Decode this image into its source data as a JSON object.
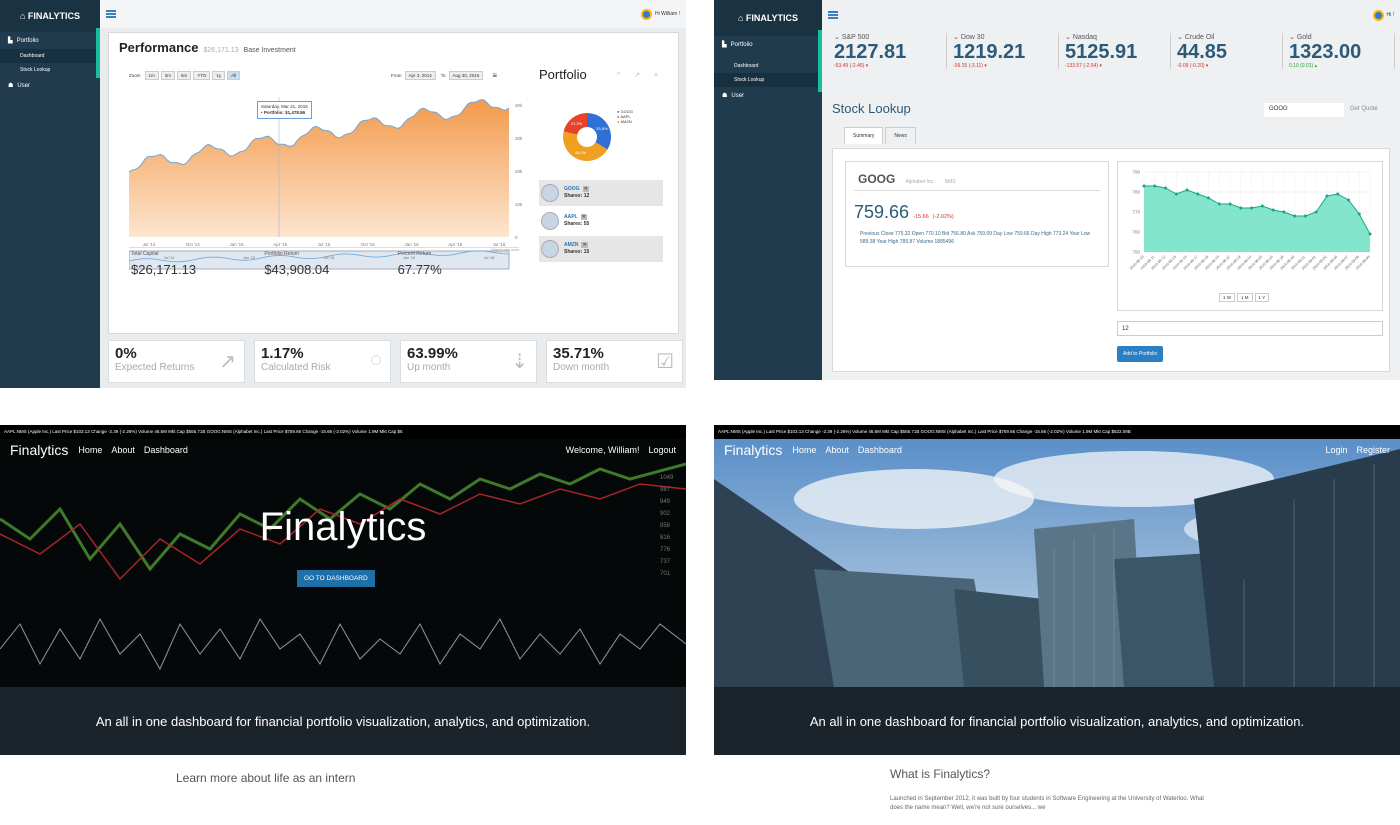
{
  "dashboard": {
    "brand": "FINALYTICS",
    "sidebar": [
      {
        "label": "Portfolio"
      },
      {
        "label": "Dashboard"
      },
      {
        "label": "Stock Lookup"
      },
      {
        "label": "User"
      }
    ],
    "user": "Hi William !",
    "title": "Performance",
    "base_amount": "$26,171.13",
    "base_label": "Base Investment",
    "zoom_label": "Zoom",
    "zoom_buttons": [
      "1m",
      "3m",
      "6m",
      "YTD",
      "1y",
      "All"
    ],
    "from_label": "From",
    "from_date": "Apr 3, 2014",
    "to_label": "To",
    "to_date": "Aug 30, 2016",
    "tooltip_date": "Saturday, Mar 21, 2015",
    "tooltip_value": "• Portfolio: $1,478.86",
    "y_ticks": [
      "40k",
      "30k",
      "20k",
      "10k",
      "0"
    ],
    "x_ticks": [
      "Jul '14",
      "Oct '14",
      "Jan '15",
      "Apr '15",
      "Jul '15",
      "Oct '15",
      "Jan '16",
      "Apr '16",
      "Jul '16"
    ],
    "nav_ticks": [
      "Jul '14",
      "Jan '15",
      "Jul '15",
      "Jan '16",
      "Jul '16"
    ],
    "credit": "Highcharts.com",
    "summary": [
      {
        "label": "Total Capital",
        "value": "$26,171.13"
      },
      {
        "label": "Portfolio Return",
        "value": "$43,908.04"
      },
      {
        "label": "Percent Return",
        "value": "67.77%"
      }
    ],
    "portfolio_title": "Portfolio",
    "pie_legend": [
      "GOOG",
      "AAPL",
      "AMZN"
    ],
    "pie_labels": [
      "33.8%",
      "45.0%",
      "21.2%"
    ],
    "pie_colors": [
      "#2f6fd6",
      "#f0a020",
      "#e8412c"
    ],
    "holdings": [
      {
        "ticker": "GOOG",
        "shares": "Shares: 12"
      },
      {
        "ticker": "AAPL",
        "shares": "Shares: 55"
      },
      {
        "ticker": "AMZN",
        "shares": "Shares: 15"
      }
    ],
    "stats": [
      {
        "value": "0%",
        "label": "Expected Returns",
        "icon": "trend-chart-icon"
      },
      {
        "value": "1.17%",
        "label": "Calculated Risk",
        "icon": "chat-bubble-icon"
      },
      {
        "value": "63.99%",
        "label": "Up month",
        "icon": "sort-down-icon"
      },
      {
        "value": "35.71%",
        "label": "Down month",
        "icon": "checkbox-icon"
      }
    ]
  },
  "lookup": {
    "brand": "FINALYTICS",
    "user": "Hi !",
    "sidebar": [
      {
        "label": "Portfolio"
      },
      {
        "label": "Dashboard"
      },
      {
        "label": "Stock Lookup"
      },
      {
        "label": "User"
      }
    ],
    "indices": [
      {
        "name": "S&P 500",
        "value": "2127.81",
        "change": "-53.49 (-2.45)",
        "up": false
      },
      {
        "name": "Dow 30",
        "value": "1219.21",
        "change": "-39.15 (-3.11)",
        "up": false
      },
      {
        "name": "Nasdaq",
        "value": "5125.91",
        "change": "-133.57 (-2.54)",
        "up": false
      },
      {
        "name": "Crude Oil",
        "value": "44.85",
        "change": "-0.09 (-0.20)",
        "up": false
      },
      {
        "name": "Gold",
        "value": "1323.00",
        "change": "0.10 (0.01)",
        "up": true
      },
      {
        "name": "10-Yr Bond",
        "value": "1.67",
        "change": "0.06 (3.47)",
        "up": true
      }
    ],
    "title": "Stock Lookup",
    "search_value": "GOOG",
    "get_quote": "Get Quote",
    "tabs": [
      "Summary",
      "News"
    ],
    "ticker": "GOOG",
    "company": "Alphabet Inc.",
    "exchange": "NMS",
    "price": "759.66",
    "change": "-15.66",
    "change_pct": "(-2.02%)",
    "details": "Previous Close 775.32 Open 770.10 Bid 756.80 Ask 759.09 Day Low 759.66 Day High 773.24 Year Low 589.38 Year High 789.87 Volume 1885496",
    "range_buttons": [
      "1 W",
      "1 M",
      "1 Y"
    ],
    "shares_input": "12",
    "add_button": "Add to Portfolio"
  },
  "chart_data": {
    "type": "area",
    "title": "",
    "y_ticks": [
      750,
      760,
      770,
      780,
      790
    ],
    "ylim": [
      750,
      790
    ],
    "x": [
      "2016-08-10",
      "2016-08-11",
      "2016-08-12",
      "2016-08-15",
      "2016-08-16",
      "2016-08-17",
      "2016-08-18",
      "2016-08-19",
      "2016-08-22",
      "2016-08-23",
      "2016-08-24",
      "2016-08-25",
      "2016-08-26",
      "2016-08-29",
      "2016-08-30",
      "2016-08-31",
      "2016-09-01",
      "2016-09-02",
      "2016-09-06",
      "2016-09-07",
      "2016-09-08",
      "2016-09-09"
    ],
    "series": [
      {
        "values": [
          783,
          783,
          782,
          779,
          781,
          779,
          777,
          774,
          774,
          772,
          772,
          773,
          771,
          770,
          768,
          768,
          770,
          778,
          779,
          776,
          769,
          759
        ]
      }
    ]
  },
  "landing_user": {
    "ticker": "AAPL:NMS (Apple Inc.)   Last Price $103.13   Change -2.39 (-2.26%)   Volume 46.6M   Mkt Cap $555.71B       GOOG:NMS (Alphabet Inc.)   Last Price $759.66   Change -15.66 (-2.02%)   Volume 1.9M   Mkt Cap $5",
    "brand": "Finalytics",
    "nav": [
      "Home",
      "About",
      "Dashboard"
    ],
    "welcome": "Welcome, William!",
    "logout": "Logout",
    "hero_title": "Finalytics",
    "cta": "GO TO DASHBOARD",
    "tagline": "An all in one dashboard for financial portfolio visualization, analytics, and optimization.",
    "section_title": "Learn more about life as an intern"
  },
  "landing_guest": {
    "ticker": "AAPL:NMS (Apple Inc.)   Last Price $103.13   Change -2.39 (-2.26%)   Volume 46.6M   Mkt Cap $555.71B       GOOG:NMS (Alphabet Inc.)   Last Price $759.66   Change -15.66 (-2.02%)   Volume 1.9M   Mkt Cap $522.09B",
    "brand": "Finalytics",
    "nav": [
      "Home",
      "About",
      "Dashboard"
    ],
    "login": "Login",
    "register": "Register",
    "tagline": "An all in one dashboard for financial portfolio visualization, analytics, and optimization.",
    "section_title": "What is Finalytics?",
    "section_text": "Launched in September 2012, it was built by four students in Software Engineering at the University of Waterloo. What does the name mean? Well, we're not sure ourselves... we"
  }
}
